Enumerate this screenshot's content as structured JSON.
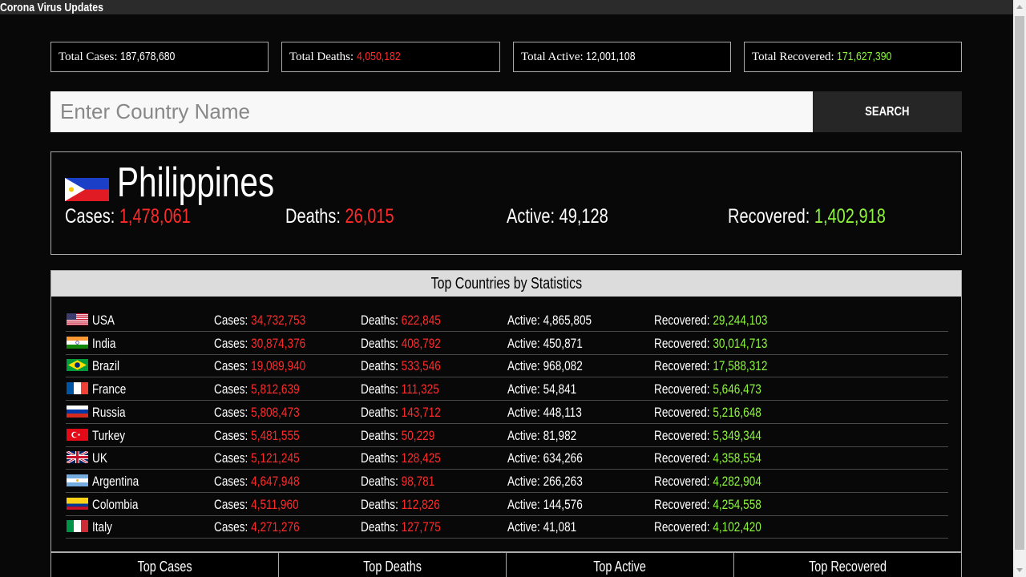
{
  "window": {
    "title": "Corona Virus Updates"
  },
  "totals": [
    {
      "label": "Total Cases:",
      "value": "187,678,680",
      "color": "#ffffff"
    },
    {
      "label": "Total Deaths:",
      "value": "4,050,182",
      "color": "#ff2a2a"
    },
    {
      "label": "Total Active:",
      "value": "12,001,108",
      "color": "#ffffff"
    },
    {
      "label": "Total Recovered:",
      "value": "171,627,390",
      "color": "#8cf53c"
    }
  ],
  "search": {
    "placeholder": "Enter Country Name",
    "value": "",
    "button_label": "SEARCH"
  },
  "country": {
    "name": "Philippines",
    "flag_icon": "philippines-flag-icon",
    "cases_label": "Cases:",
    "cases": "1,478,061",
    "deaths_label": "Deaths:",
    "deaths": "26,015",
    "active_label": "Active:",
    "active": "49,128",
    "recovered_label": "Recovered:",
    "recovered": "1,402,918"
  },
  "top": {
    "header": "Top Countries by Statistics",
    "labels": {
      "cases": "Cases:",
      "deaths": "Deaths:",
      "active": "Active:",
      "recovered": "Recovered:"
    },
    "rows": [
      {
        "country": "USA",
        "flag": "usa-flag-icon",
        "cases": "34,732,753",
        "deaths": "622,845",
        "active": "4,865,805",
        "recovered": "29,244,103"
      },
      {
        "country": "India",
        "flag": "india-flag-icon",
        "cases": "30,874,376",
        "deaths": "408,792",
        "active": "450,871",
        "recovered": "30,014,713"
      },
      {
        "country": "Brazil",
        "flag": "brazil-flag-icon",
        "cases": "19,089,940",
        "deaths": "533,546",
        "active": "968,082",
        "recovered": "17,588,312"
      },
      {
        "country": "France",
        "flag": "france-flag-icon",
        "cases": "5,812,639",
        "deaths": "111,325",
        "active": "54,841",
        "recovered": "5,646,473"
      },
      {
        "country": "Russia",
        "flag": "russia-flag-icon",
        "cases": "5,808,473",
        "deaths": "143,712",
        "active": "448,113",
        "recovered": "5,216,648"
      },
      {
        "country": "Turkey",
        "flag": "turkey-flag-icon",
        "cases": "5,481,555",
        "deaths": "50,229",
        "active": "81,982",
        "recovered": "5,349,344"
      },
      {
        "country": "UK",
        "flag": "uk-flag-icon",
        "cases": "5,121,245",
        "deaths": "128,425",
        "active": "634,266",
        "recovered": "4,358,554"
      },
      {
        "country": "Argentina",
        "flag": "argentina-flag-icon",
        "cases": "4,647,948",
        "deaths": "98,781",
        "active": "266,263",
        "recovered": "4,282,904"
      },
      {
        "country": "Colombia",
        "flag": "colombia-flag-icon",
        "cases": "4,511,960",
        "deaths": "112,826",
        "active": "144,576",
        "recovered": "4,254,558"
      },
      {
        "country": "Italy",
        "flag": "italy-flag-icon",
        "cases": "4,271,276",
        "deaths": "127,775",
        "active": "41,081",
        "recovered": "4,102,420"
      }
    ]
  },
  "tabs": [
    "Top Cases",
    "Top Deaths",
    "Top Active",
    "Top Recovered"
  ],
  "colors": {
    "cases": "#ff2a2a",
    "deaths": "#ff2a2a",
    "recovered": "#8cf53c",
    "active": "#ffffff"
  }
}
